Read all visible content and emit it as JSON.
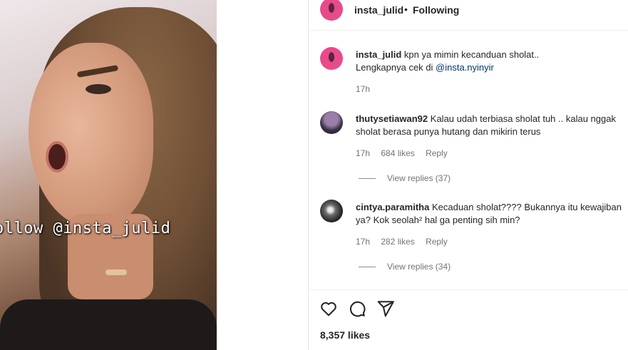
{
  "media": {
    "overlay_text": "ollow @insta_julid"
  },
  "header": {
    "username": "insta_julid",
    "separator": "•",
    "follow_status": "Following"
  },
  "caption": {
    "username": "insta_julid",
    "text": "kpn ya mimin kecanduan sholat..",
    "line2_prefix": "Lengkapnya cek di ",
    "mention": "@insta.nyinyir",
    "time": "17h"
  },
  "comments": [
    {
      "username": "thutysetiawan92",
      "text": "Kalau udah terbiasa sholat tuh .. kalau nggak sholat berasa punya hutang dan mikirin terus",
      "time": "17h",
      "likes": "684 likes",
      "reply_label": "Reply",
      "view_replies": "View replies (37)"
    },
    {
      "username": "cintya.paramitha",
      "text": "Kecaduan sholat???? Bukannya itu kewajiban ya? Kok seolah² hal ga penting sih min?",
      "time": "17h",
      "likes": "282 likes",
      "reply_label": "Reply",
      "view_replies": "View replies (34)"
    }
  ],
  "actions": {
    "like_icon": "heart-icon",
    "comment_icon": "comment-icon",
    "share_icon": "share-icon",
    "likes_count": "8,357 likes"
  },
  "colors": {
    "accent_link": "#00376b",
    "muted": "#737373",
    "text": "#262626"
  }
}
